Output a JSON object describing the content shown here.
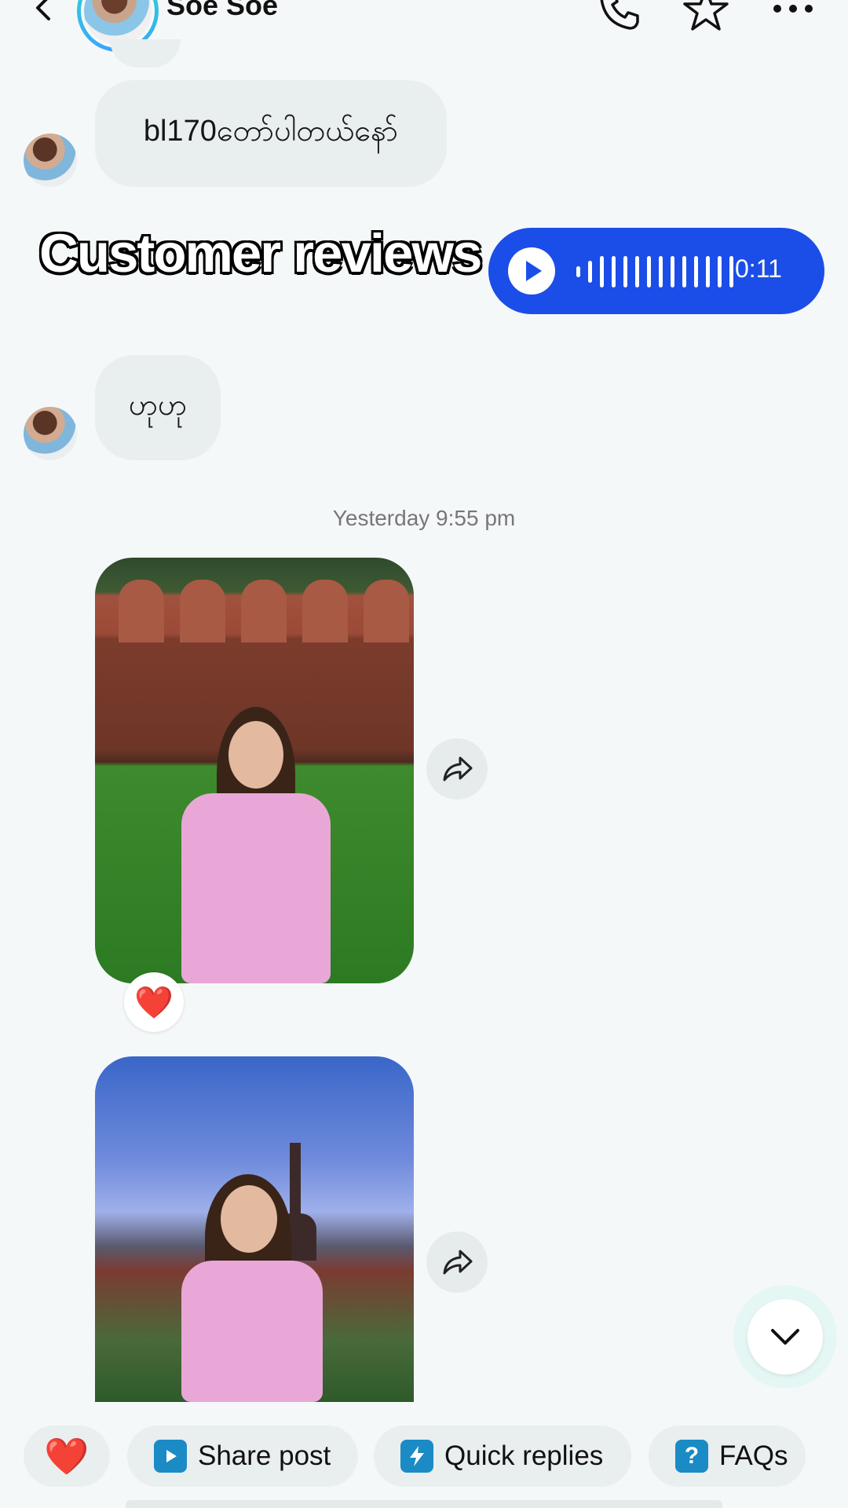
{
  "header": {
    "contact_name": "Soe Soe",
    "icons": {
      "back": "back-arrow-icon",
      "call": "phone-icon",
      "favorite": "star-icon",
      "more": "more-icon"
    }
  },
  "messages": [
    {
      "type": "text",
      "sender": "contact",
      "text": "bl170တော်ပါတယ်နော်"
    },
    {
      "type": "voice",
      "sender": "me",
      "duration": "0:11"
    },
    {
      "type": "text",
      "sender": "contact",
      "text": "ဟုဟု"
    }
  ],
  "overlay_caption": "Customer reviews",
  "timestamp": "Yesterday 9:55 pm",
  "photos": [
    {
      "reaction": "❤️"
    },
    {
      "reaction": ""
    }
  ],
  "quick_chips": [
    {
      "id": "heart",
      "label": "❤️"
    },
    {
      "id": "share",
      "label": "Share post",
      "icon": "play-square-icon"
    },
    {
      "id": "quick",
      "label": "Quick replies",
      "icon": "lightning-icon"
    },
    {
      "id": "faq",
      "label": "FAQs",
      "icon": "question-icon"
    }
  ],
  "colors": {
    "accent": "#1b4ee8",
    "background": "#f5f8f9",
    "bubble": "#e9eeef",
    "heart": "#e0142c",
    "chip_icon": "#1a8bc4"
  }
}
